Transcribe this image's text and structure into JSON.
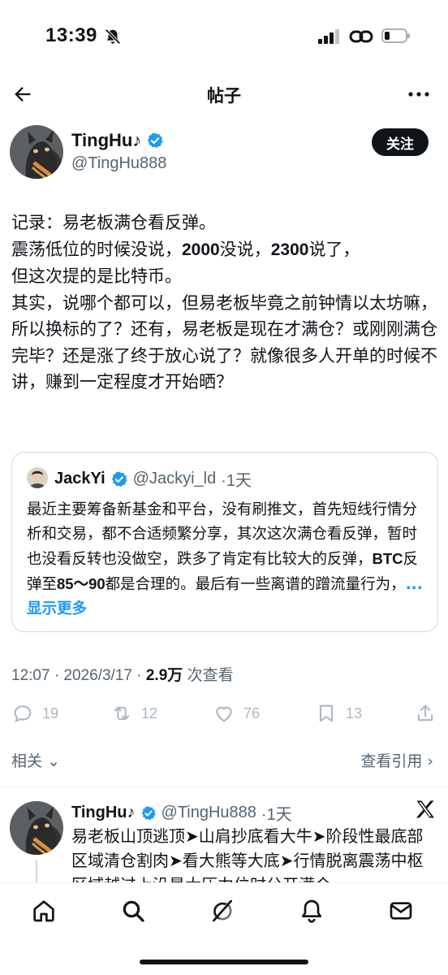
{
  "status_bar": {
    "time": "13:39"
  },
  "header": {
    "title": "帖子"
  },
  "author": {
    "name": "TingHu♪",
    "handle": "@TingHu888",
    "follow_label": "关注"
  },
  "post": {
    "lines": [
      "记录：易老板满仓看反弹。",
      "震荡低位的时候没说，",
      "2000",
      "没说，",
      "2300",
      "说了，",
      "但这次提的是比特币。",
      "其实，说哪个都可以，但易老板毕竟之前钟情以太坊嘛，所以换标的了？还有，易老板是现在才满仓？或刚刚满仓完毕？还是涨了终于放心说了？就像很多人开单的时候不讲，赚到一定程度才开始晒？"
    ]
  },
  "quote": {
    "name": "JackYi",
    "handle": "@Jackyi_ld",
    "time": "·1天",
    "text_1": "最近主要筹备新基金和平台，没有刷推文，首先短线行情分析和交易，都不合适频繁分享，其次这次满仓看反弹，暂时也没看反转也没做空，跌多了肯定有比较大的反弹，",
    "btc": "BTC",
    "text_2": "反弹至",
    "range": "85～90",
    "text_3": "都是合理的。最后有一些离谱的蹭流量行为，",
    "show_more": "... 显示更多"
  },
  "meta": {
    "time": "12:07",
    "date": "· 2026/3/17 ·",
    "views_count": "2.9万",
    "views_label": "次查看"
  },
  "actions": {
    "replies": "19",
    "reposts": "12",
    "likes": "76",
    "bookmarks": "13"
  },
  "related": {
    "label": "相关",
    "view_quotes": "查看引用"
  },
  "reply": {
    "name": "TingHu♪",
    "handle": "@TingHu888",
    "time": "·1天",
    "text": "易老板山顶逃顶➤山肩抄底看大牛➤阶段性最底部区域清仓割肉➤看大熊等大底➤行情脱离震荡中枢区域越过上沿最大压力位时公开满仓"
  },
  "colors": {
    "accent": "#1d9bf0",
    "text": "#0f1419",
    "secondary": "#536471"
  }
}
